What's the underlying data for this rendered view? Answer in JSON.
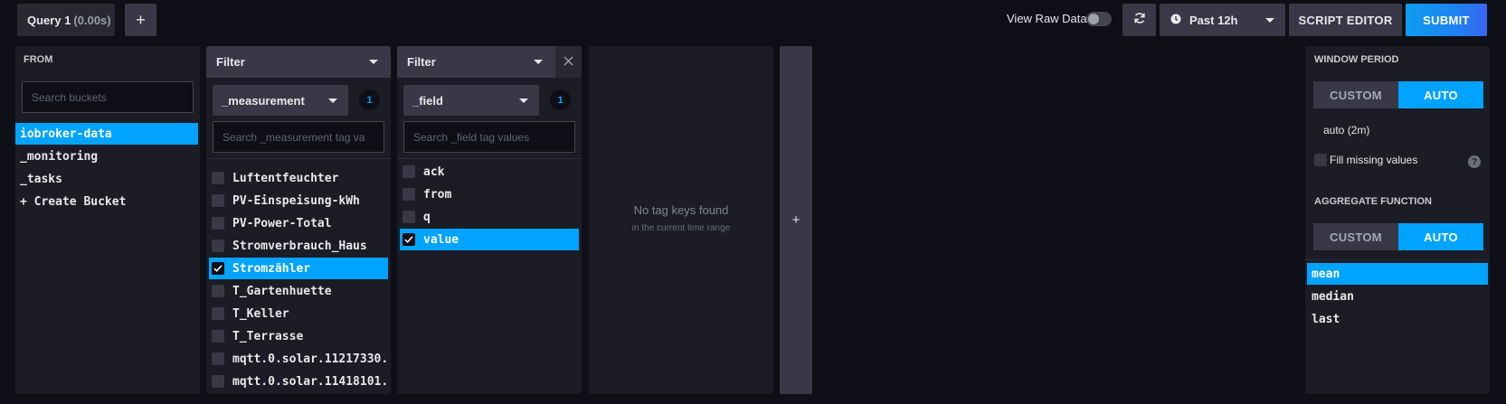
{
  "topbar": {
    "query_tab_label": "Query 1",
    "query_tab_time": "(0.00s)",
    "add_tab": "+",
    "view_raw_label": "View Raw Data",
    "time_range": "Past 12h",
    "script_editor": "SCRIPT EDITOR",
    "submit": "SUBMIT"
  },
  "from_panel": {
    "title": "FROM",
    "search_placeholder": "Search buckets",
    "buckets": [
      "iobroker-data",
      "_monitoring",
      "_tasks"
    ],
    "selected_bucket": "iobroker-data",
    "create_bucket": "+ Create Bucket"
  },
  "filter1": {
    "title": "Filter",
    "key": "_measurement",
    "count": "1",
    "search_placeholder": "Search _measurement tag va",
    "values": [
      "Luftentfeuchter",
      "PV-Einspeisung-kWh",
      "PV-Power-Total",
      "Stromverbrauch_Haus",
      "Stromzähler",
      "T_Gartenhuette",
      "T_Keller",
      "T_Terrasse",
      "mqtt.0.solar.11217330...",
      "mqtt.0.solar.11418101..."
    ],
    "selected": "Stromzähler"
  },
  "filter2": {
    "title": "Filter",
    "key": "_field",
    "count": "1",
    "search_placeholder": "Search _field tag values",
    "values": [
      "ack",
      "from",
      "q",
      "value"
    ],
    "selected": "value"
  },
  "filter3": {
    "empty_title": "No tag keys found",
    "empty_sub": "in the current time range"
  },
  "add_filter": "+",
  "right_panel": {
    "window_period_label": "WINDOW PERIOD",
    "custom": "CUSTOM",
    "auto": "AUTO",
    "auto_value": "auto (2m)",
    "fill_missing": "Fill missing values",
    "help": "?",
    "aggregate_label": "AGGREGATE FUNCTION",
    "functions": [
      "mean",
      "median",
      "last"
    ],
    "selected_function": "mean"
  },
  "colors": {
    "accent": "#00a3ff",
    "panel": "#1c1c26",
    "background": "#0f0f17"
  }
}
